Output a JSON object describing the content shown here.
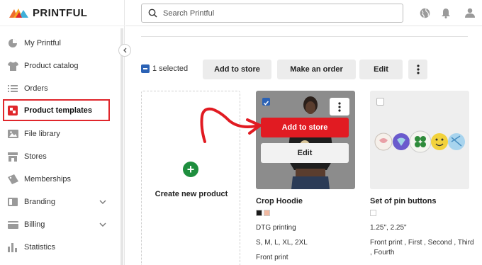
{
  "brand": {
    "name": "PRINTFUL"
  },
  "search": {
    "placeholder": "Search Printful"
  },
  "sidebar": {
    "items": [
      {
        "label": "My Printful",
        "icon": "pie-chart-icon"
      },
      {
        "label": "Product catalog",
        "icon": "tshirt-icon"
      },
      {
        "label": "Orders",
        "icon": "list-icon"
      },
      {
        "label": "Product templates",
        "icon": "templates-icon",
        "active": true
      },
      {
        "label": "File library",
        "icon": "image-icon"
      },
      {
        "label": "Stores",
        "icon": "store-icon"
      },
      {
        "label": "Memberships",
        "icon": "tag-icon"
      },
      {
        "label": "Branding",
        "icon": "branding-icon",
        "expandable": true
      },
      {
        "label": "Billing",
        "icon": "card-icon",
        "expandable": true
      },
      {
        "label": "Statistics",
        "icon": "bar-chart-icon"
      }
    ]
  },
  "toolbar": {
    "selected_label": "1 selected",
    "add_to_store": "Add to store",
    "make_order": "Make an order",
    "edit": "Edit"
  },
  "create_new": {
    "label": "Create new product"
  },
  "products": [
    {
      "title": "Crop Hoodie",
      "colors": [
        "#1a1a1a",
        "#f1b9a1"
      ],
      "printing": "DTG printing",
      "sizes": "S, M, L, XL, 2XL",
      "placement": "Front print",
      "add_to_store_label": "Add to store",
      "edit_label": "Edit"
    },
    {
      "title": "Set of pin buttons",
      "colors": [
        "#ffffff"
      ],
      "size_line": "1.25\", 2.25\"",
      "placement_line1": "Front print , First , Second , Third",
      "placement_line2": ", Fourth"
    }
  ],
  "colors": {
    "accent_red": "#e11b22",
    "highlight": "#e0262b",
    "select_blue": "#2b62b5",
    "plus_green": "#1e8e3e"
  }
}
